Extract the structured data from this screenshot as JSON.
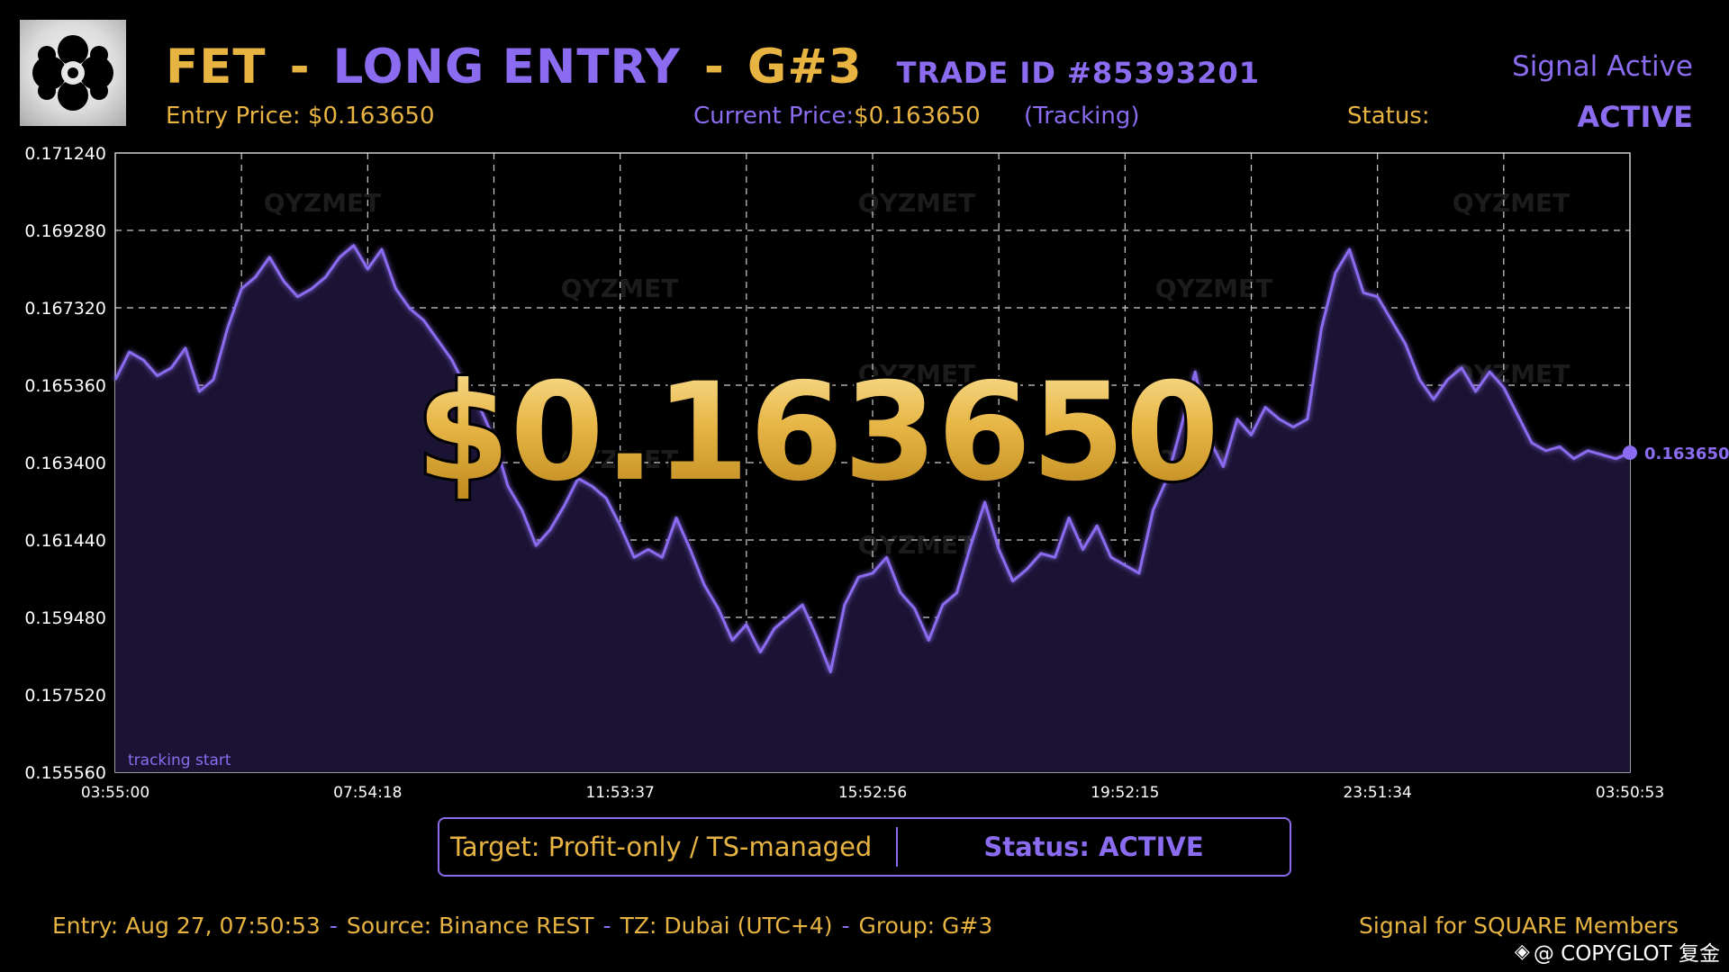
{
  "header": {
    "logo_icon": "abstract-blob-logo",
    "symbol": "FET",
    "separator": "-",
    "direction": "LONG ENTRY",
    "group": "G#3",
    "trade_id": "TRADE ID #85393201",
    "signal_state": "Signal Active",
    "entry_label": "Entry Price:",
    "entry_value": "$0.163650",
    "current_label": "Current Price:",
    "current_value": "$0.163650",
    "tracking": "(Tracking)",
    "status_label": "Status:",
    "status_value": "ACTIVE"
  },
  "chart_data": {
    "type": "area",
    "y_ticks": [
      "0.171240",
      "0.169280",
      "0.167320",
      "0.165360",
      "0.163400",
      "0.161440",
      "0.159480",
      "0.157520",
      "0.155560"
    ],
    "x_ticks": [
      "03:55:00",
      "07:54:18",
      "11:53:37",
      "15:52:56",
      "19:52:15",
      "23:51:34",
      "03:50:53"
    ],
    "ylim": [
      0.15556,
      0.17124
    ],
    "grid": true,
    "big_price": "$0.163650",
    "last_label": "0.163650",
    "annotation": "tracking start",
    "watermark": "QYZMET",
    "line_color": "#8b6cf0",
    "fill_color": "#1a1333",
    "series": [
      {
        "values": [
          0.1655,
          0.1662,
          0.166,
          0.1656,
          0.1658,
          0.1663,
          0.1652,
          0.1655,
          0.1668,
          0.1678,
          0.1681,
          0.1686,
          0.168,
          0.1676,
          0.1678,
          0.1681,
          0.1686,
          0.1689,
          0.1683,
          0.1688,
          0.1678,
          0.1673,
          0.167,
          0.1665,
          0.166,
          0.1653,
          0.1648,
          0.164,
          0.1628,
          0.1622,
          0.1613,
          0.1617,
          0.1623,
          0.163,
          0.1628,
          0.1625,
          0.1618,
          0.161,
          0.1612,
          0.161,
          0.162,
          0.1612,
          0.1603,
          0.1597,
          0.1589,
          0.1593,
          0.1586,
          0.1592,
          0.1595,
          0.1598,
          0.159,
          0.1581,
          0.1598,
          0.1605,
          0.1606,
          0.161,
          0.1601,
          0.1597,
          0.1589,
          0.1598,
          0.1601,
          0.1613,
          0.1624,
          0.1612,
          0.1604,
          0.1607,
          0.1611,
          0.161,
          0.162,
          0.1612,
          0.1618,
          0.161,
          0.1608,
          0.1606,
          0.1622,
          0.163,
          0.1643,
          0.1657,
          0.164,
          0.1633,
          0.1645,
          0.1641,
          0.1648,
          0.1645,
          0.1643,
          0.1645,
          0.1668,
          0.1682,
          0.1688,
          0.1677,
          0.1676,
          0.167,
          0.1664,
          0.1655,
          0.165,
          0.1655,
          0.1658,
          0.1652,
          0.1657,
          0.1653,
          0.1646,
          0.1639,
          0.1637,
          0.1638,
          0.1635,
          0.1637,
          0.1636,
          0.1635,
          0.16365
        ]
      }
    ]
  },
  "target": {
    "text": "Target: Profit-only / TS-managed",
    "status": "Status: ACTIVE"
  },
  "footer": {
    "entry": "Entry: Aug 27, 07:50:53",
    "dash": "-",
    "source": "Source: Binance REST",
    "tz": "TZ: Dubai (UTC+4)",
    "group": "Group: G#3",
    "members": "Signal for SQUARE Members",
    "credit": "@ COPYGLOT 复金"
  },
  "colors": {
    "gold": "#e8b441",
    "purple": "#8b6cf0",
    "background": "#000000"
  }
}
